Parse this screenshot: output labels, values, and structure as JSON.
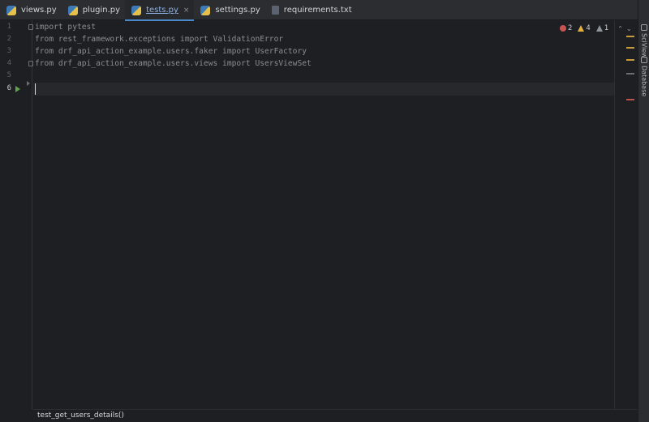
{
  "tabs": [
    {
      "label": "views.py",
      "type": "py",
      "active": false
    },
    {
      "label": "plugin.py",
      "type": "py",
      "active": false
    },
    {
      "label": "tests.py",
      "type": "py",
      "active": true
    },
    {
      "label": "settings.py",
      "type": "py",
      "active": false
    },
    {
      "label": "requirements.txt",
      "type": "txt",
      "active": false
    }
  ],
  "tab_close_glyph": "×",
  "editor": {
    "lines": [
      {
        "number": "1",
        "text": "import pytest"
      },
      {
        "number": "2",
        "text": "from rest_framework.exceptions import ValidationError"
      },
      {
        "number": "3",
        "text": "from drf_api_action_example.users.faker import UserFactory"
      },
      {
        "number": "4",
        "text": "from drf_api_action_example.users.views import UsersViewSet"
      },
      {
        "number": "5",
        "text": ""
      },
      {
        "number": "6",
        "text": ""
      }
    ],
    "current_line": "6"
  },
  "inspections": {
    "errors": "2",
    "warnings": "4",
    "weak_warnings": "1",
    "up_glyph": "⌃",
    "down_glyph": "⌄"
  },
  "right_tools": [
    {
      "label": "SciView",
      "icon": "sciview-icon"
    },
    {
      "label": "Database",
      "icon": "database-icon"
    }
  ],
  "breadcrumb": "test_get_users_details()",
  "colors": {
    "background": "#1e1f22",
    "tab_active_underline": "#4a88c7",
    "error": "#c75450",
    "warning": "#e3b341",
    "run_gutter": "#5fa34b"
  }
}
